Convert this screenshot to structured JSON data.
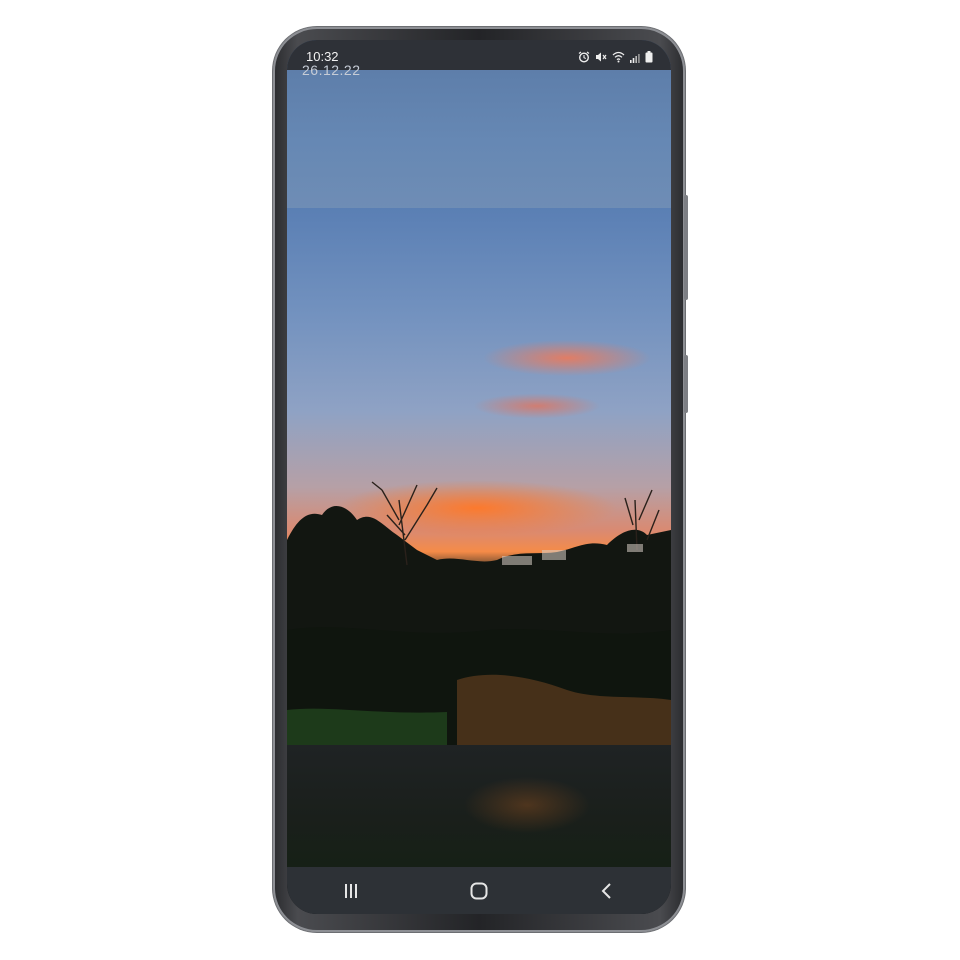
{
  "status_bar": {
    "time": "10:32",
    "date": "26.12.22",
    "icons": [
      "alarm-icon",
      "mute-icon",
      "wifi-icon",
      "signal-icon",
      "battery-icon"
    ]
  },
  "wallpaper": {
    "description_colors": {
      "sky_top": "#5a7aa6",
      "sunset_orange": "#f58b48",
      "foreground_dark": "#1a1d17"
    }
  },
  "nav_bar": {
    "buttons": [
      "recent-apps-icon",
      "home-icon",
      "back-icon"
    ]
  }
}
